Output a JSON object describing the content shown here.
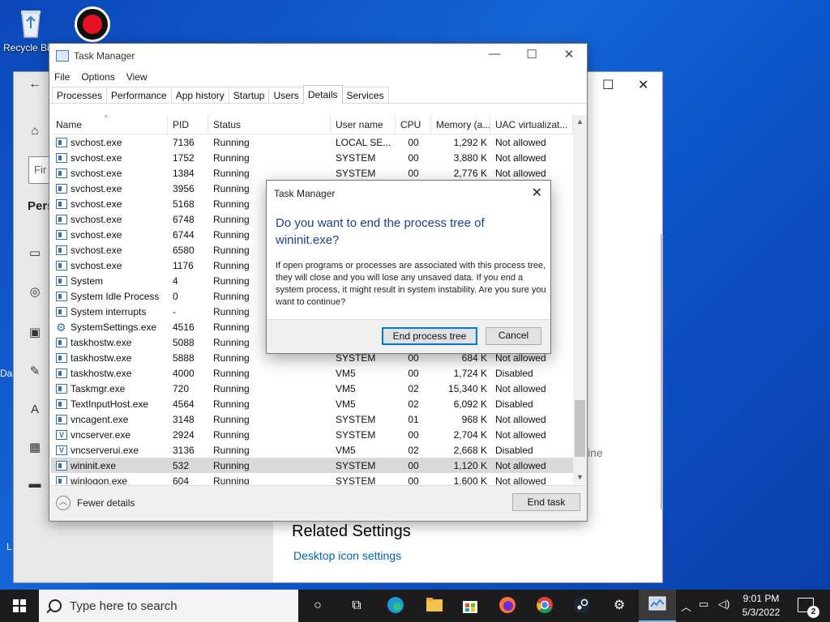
{
  "desktop": {
    "recycle_label": "Recycle Bin",
    "left_strip_da": "Da",
    "left_strip_l": "L"
  },
  "settings": {
    "back": "←",
    "find_placeholder": "Fir",
    "pers_label": "Pers",
    "related_title": "Related Settings",
    "desktop_icon_link": "Desktop icon settings",
    "ine_fragment": "ine"
  },
  "taskmgr": {
    "title": "Task Manager",
    "menu": [
      "File",
      "Options",
      "View"
    ],
    "tabs": [
      "Processes",
      "Performance",
      "App history",
      "Startup",
      "Users",
      "Details",
      "Services"
    ],
    "active_tab": "Details",
    "columns": [
      "Name",
      "PID",
      "Status",
      "User name",
      "CPU",
      "Memory (a...",
      "UAC virtualizat..."
    ],
    "rows": [
      {
        "name": "svchost.exe",
        "pid": "7136",
        "status": "Running",
        "user": "LOCAL SE...",
        "cpu": "00",
        "mem": "1,292 K",
        "uac": "Not allowed",
        "icon": "process-icon"
      },
      {
        "name": "svchost.exe",
        "pid": "1752",
        "status": "Running",
        "user": "SYSTEM",
        "cpu": "00",
        "mem": "3,880 K",
        "uac": "Not allowed",
        "icon": "process-icon"
      },
      {
        "name": "svchost.exe",
        "pid": "1384",
        "status": "Running",
        "user": "SYSTEM",
        "cpu": "00",
        "mem": "2,776 K",
        "uac": "Not allowed",
        "icon": "process-icon"
      },
      {
        "name": "svchost.exe",
        "pid": "3956",
        "status": "Running",
        "user": "",
        "cpu": "",
        "mem": "",
        "uac": "",
        "icon": "process-icon"
      },
      {
        "name": "svchost.exe",
        "pid": "5168",
        "status": "Running",
        "user": "",
        "cpu": "",
        "mem": "",
        "uac": "",
        "icon": "process-icon"
      },
      {
        "name": "svchost.exe",
        "pid": "6748",
        "status": "Running",
        "user": "",
        "cpu": "",
        "mem": "",
        "uac": "",
        "icon": "process-icon"
      },
      {
        "name": "svchost.exe",
        "pid": "6744",
        "status": "Running",
        "user": "",
        "cpu": "",
        "mem": "",
        "uac": "",
        "icon": "process-icon"
      },
      {
        "name": "svchost.exe",
        "pid": "6580",
        "status": "Running",
        "user": "",
        "cpu": "",
        "mem": "",
        "uac": "",
        "icon": "process-icon"
      },
      {
        "name": "svchost.exe",
        "pid": "1176",
        "status": "Running",
        "user": "",
        "cpu": "",
        "mem": "",
        "uac": "",
        "icon": "process-icon"
      },
      {
        "name": "System",
        "pid": "4",
        "status": "Running",
        "user": "",
        "cpu": "",
        "mem": "",
        "uac": "",
        "icon": "process-icon"
      },
      {
        "name": "System Idle Process",
        "pid": "0",
        "status": "Running",
        "user": "",
        "cpu": "",
        "mem": "",
        "uac": "",
        "icon": "process-icon"
      },
      {
        "name": "System interrupts",
        "pid": "-",
        "status": "Running",
        "user": "",
        "cpu": "",
        "mem": "",
        "uac": "",
        "icon": "process-icon"
      },
      {
        "name": "SystemSettings.exe",
        "pid": "4516",
        "status": "Running",
        "user": "",
        "cpu": "",
        "mem": "",
        "uac": "",
        "icon": "gear-icon"
      },
      {
        "name": "taskhostw.exe",
        "pid": "5088",
        "status": "Running",
        "user": "",
        "cpu": "",
        "mem": "",
        "uac": "",
        "icon": "process-icon"
      },
      {
        "name": "taskhostw.exe",
        "pid": "5888",
        "status": "Running",
        "user": "SYSTEM",
        "cpu": "00",
        "mem": "684 K",
        "uac": "Not allowed",
        "icon": "process-icon"
      },
      {
        "name": "taskhostw.exe",
        "pid": "4000",
        "status": "Running",
        "user": "VM5",
        "cpu": "00",
        "mem": "1,724 K",
        "uac": "Disabled",
        "icon": "process-icon"
      },
      {
        "name": "Taskmgr.exe",
        "pid": "720",
        "status": "Running",
        "user": "VM5",
        "cpu": "02",
        "mem": "15,340 K",
        "uac": "Not allowed",
        "icon": "process-icon"
      },
      {
        "name": "TextInputHost.exe",
        "pid": "4564",
        "status": "Running",
        "user": "VM5",
        "cpu": "02",
        "mem": "6,092 K",
        "uac": "Disabled",
        "icon": "process-icon"
      },
      {
        "name": "vncagent.exe",
        "pid": "3148",
        "status": "Running",
        "user": "SYSTEM",
        "cpu": "01",
        "mem": "968 K",
        "uac": "Not allowed",
        "icon": "process-icon"
      },
      {
        "name": "vncserver.exe",
        "pid": "2924",
        "status": "Running",
        "user": "SYSTEM",
        "cpu": "00",
        "mem": "2,704 K",
        "uac": "Not allowed",
        "icon": "vnc-icon"
      },
      {
        "name": "vncserverui.exe",
        "pid": "3136",
        "status": "Running",
        "user": "VM5",
        "cpu": "02",
        "mem": "2,668 K",
        "uac": "Disabled",
        "icon": "vnc-icon"
      },
      {
        "name": "wininit.exe",
        "pid": "532",
        "status": "Running",
        "user": "SYSTEM",
        "cpu": "00",
        "mem": "1,120 K",
        "uac": "Not allowed",
        "icon": "process-icon",
        "selected": true
      },
      {
        "name": "winlogon.exe",
        "pid": "604",
        "status": "Running",
        "user": "SYSTEM",
        "cpu": "00",
        "mem": "1,600 K",
        "uac": "Not allowed",
        "icon": "process-icon"
      }
    ],
    "fewer_details": "Fewer details",
    "end_task": "End task"
  },
  "dialog": {
    "title": "Task Manager",
    "heading": "Do you want to end the process tree of wininit.exe?",
    "body": "If open programs or processes are associated with this process tree, they will close and you will lose any unsaved data. If you end a system process, it might result in system instability. Are you sure you want to continue?",
    "primary_button": "End process tree",
    "cancel_button": "Cancel"
  },
  "taskbar": {
    "search_placeholder": "Type here to search",
    "time": "9:01 PM",
    "date": "5/3/2022",
    "notification_count": "2"
  },
  "colors": {
    "accent": "#0078d7",
    "dialog_heading": "#1c3f94",
    "link": "#0063b1"
  }
}
